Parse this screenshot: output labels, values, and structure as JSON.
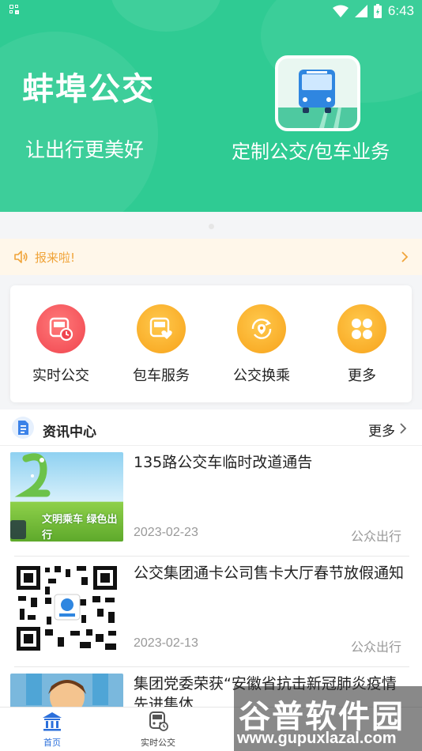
{
  "status_bar": {
    "time": "6:43"
  },
  "banner": {
    "app_title": "蚌埠公交",
    "slogan": "让出行更美好",
    "promo_text": "定制公交/包车业务"
  },
  "notice": {
    "text": "报来啦!"
  },
  "services": [
    {
      "label": "实时公交",
      "icon": "bus-clock-icon",
      "color": "#f0444e"
    },
    {
      "label": "包车服务",
      "icon": "bus-heart-icon",
      "color": "#f7a21a"
    },
    {
      "label": "公交换乘",
      "icon": "transfer-icon",
      "color": "#f7a21a"
    },
    {
      "label": "更多",
      "icon": "grid-more-icon",
      "color": "#f7a21a"
    }
  ],
  "news": {
    "title": "资讯中心",
    "more": "更多",
    "items": [
      {
        "title": "135路公交车临时改道通告",
        "date": "2023-02-23",
        "source": "公众出行",
        "thumb_text": "文明乘车 绿色出行"
      },
      {
        "title": "公交集团通卡公司售卡大厅春节放假通知",
        "date": "2023-02-13",
        "source": "公众出行"
      },
      {
        "title": "集团党委荣获“安徽省抗击新冠肺炎疫情先进集体",
        "date": "",
        "source": ""
      }
    ]
  },
  "bottom_nav": [
    {
      "label": "首页",
      "icon": "home-icon",
      "active": true
    },
    {
      "label": "实时公交",
      "icon": "bus-icon",
      "active": false
    }
  ],
  "watermark": {
    "main": "谷普软件园",
    "url": "www.gupuxlazal.com"
  },
  "colors": {
    "brand": "#2fcb93",
    "active_tab": "#2b6fdb",
    "notice": "#f0a43a"
  }
}
